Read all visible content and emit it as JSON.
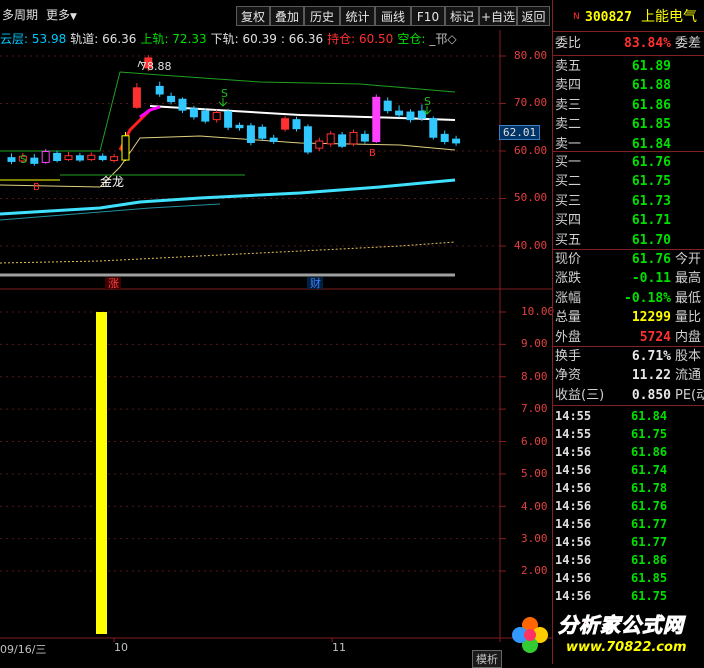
{
  "toolbar": {
    "period": "多周期",
    "more": "更多",
    "buttons": [
      "复权",
      "叠加",
      "历史",
      "统计",
      "画线",
      "F10",
      "标记",
      "+自选",
      "返回"
    ]
  },
  "indicators": [
    {
      "text": "云层: 53.98",
      "color": "#00c8ff"
    },
    {
      "text": "轨道: 66.36",
      "color": "#e0e0e0"
    },
    {
      "text": "上轨: 72.33",
      "color": "#00e000"
    },
    {
      "text": "下轨: 60.39",
      "color": "#e0e0e0"
    },
    {
      "text": ": 66.36",
      "color": "#e0e0e0"
    },
    {
      "text": "持仓: 60.50",
      "color": "#ff3030"
    },
    {
      "text": "空仓:",
      "color": "#00e000"
    },
    {
      "text": "_邗◇",
      "color": "#c0c0c0"
    }
  ],
  "main_axis": [
    "80.00",
    "70.00",
    "60.00",
    "50.00",
    "40.00"
  ],
  "current_price_tag": "62.01",
  "high_label": "78.88",
  "golden_dragon": "金龙",
  "signal_s": "S",
  "signal_b": "B",
  "markers": {
    "zhang": "涨",
    "cai": "财"
  },
  "vol_axis": [
    "10.00",
    "9.00",
    "8.00",
    "7.00",
    "6.00",
    "5.00",
    "4.00",
    "3.00",
    "2.00"
  ],
  "dates": [
    "09/16/三",
    "10",
    "11"
  ],
  "bottom_tab": "模析",
  "stock": {
    "badge": "N",
    "code": "300827",
    "name": "上能电气"
  },
  "weibi": {
    "label": "委比",
    "value": "83.84%",
    "label2": "委差"
  },
  "asks": [
    {
      "label": "卖五",
      "price": "61.89"
    },
    {
      "label": "卖四",
      "price": "61.88"
    },
    {
      "label": "卖三",
      "price": "61.86"
    },
    {
      "label": "卖二",
      "price": "61.85"
    },
    {
      "label": "卖一",
      "price": "61.84"
    }
  ],
  "bids": [
    {
      "label": "买一",
      "price": "61.76"
    },
    {
      "label": "买二",
      "price": "61.75"
    },
    {
      "label": "买三",
      "price": "61.73"
    },
    {
      "label": "买四",
      "price": "61.71"
    },
    {
      "label": "买五",
      "price": "61.70"
    }
  ],
  "quote": [
    {
      "label": "现价",
      "value": "61.76",
      "color": "#00e000",
      "label2": "今开"
    },
    {
      "label": "涨跌",
      "value": "-0.11",
      "color": "#00e000",
      "label2": "最高"
    },
    {
      "label": "涨幅",
      "value": "-0.18%",
      "color": "#00e000",
      "label2": "最低"
    },
    {
      "label": "总量",
      "value": "12299",
      "color": "#ffff00",
      "label2": "量比"
    },
    {
      "label": "外盘",
      "value": "5724",
      "color": "#ff3030",
      "label2": "内盘"
    }
  ],
  "fundamentals": [
    {
      "label": "换手",
      "value": "6.71%",
      "label2": "股本"
    },
    {
      "label": "净资",
      "value": "11.22",
      "label2": "流通"
    },
    {
      "label": "收益(三)",
      "value": "0.850",
      "label2": "PE(动"
    }
  ],
  "ticks": [
    {
      "time": "14:55",
      "price": "61.84"
    },
    {
      "time": "14:55",
      "price": "61.75"
    },
    {
      "time": "14:56",
      "price": "61.86"
    },
    {
      "time": "14:56",
      "price": "61.74"
    },
    {
      "time": "14:56",
      "price": "61.78"
    },
    {
      "time": "14:56",
      "price": "61.76"
    },
    {
      "time": "14:56",
      "price": "61.77"
    },
    {
      "time": "14:56",
      "price": "61.77"
    },
    {
      "time": "14:56",
      "price": "61.86"
    },
    {
      "time": "14:56",
      "price": "61.85"
    },
    {
      "time": "14:56",
      "price": "61.75"
    }
  ],
  "watermark": {
    "text": "分析家公式网",
    "url": "www.70822.com"
  },
  "candles": [
    {
      "o": 58.6,
      "c": 57.8,
      "h": 59.5,
      "l": 57.2
    },
    {
      "o": 57.9,
      "c": 58.9,
      "h": 59.6,
      "l": 57.5
    },
    {
      "o": 58.5,
      "c": 57.4,
      "h": 59.4,
      "l": 56.9
    },
    {
      "o": 57.6,
      "c": 59.9,
      "h": 60.4,
      "l": 57.3
    },
    {
      "o": 59.5,
      "c": 58.0,
      "h": 60.1,
      "l": 57.6
    },
    {
      "o": 58.2,
      "c": 59.0,
      "h": 59.8,
      "l": 57.9
    },
    {
      "o": 59.0,
      "c": 58.1,
      "h": 59.6,
      "l": 57.7
    },
    {
      "o": 58.2,
      "c": 59.1,
      "h": 59.7,
      "l": 57.9
    },
    {
      "o": 58.9,
      "c": 58.2,
      "h": 59.5,
      "l": 57.8
    },
    {
      "o": 58.0,
      "c": 58.8,
      "h": 59.4,
      "l": 57.6
    },
    {
      "o": 58.1,
      "c": 63.2,
      "h": 64.0,
      "l": 57.9
    },
    {
      "o": 69.2,
      "c": 73.3,
      "h": 74.3,
      "l": 68.9
    },
    {
      "o": 77.5,
      "c": 79.6,
      "h": 80.2,
      "l": 76.8
    },
    {
      "o": 73.6,
      "c": 72.0,
      "h": 74.6,
      "l": 71.4
    },
    {
      "o": 71.5,
      "c": 70.4,
      "h": 72.3,
      "l": 69.8
    },
    {
      "o": 70.9,
      "c": 68.6,
      "h": 71.3,
      "l": 68.0
    },
    {
      "o": 68.9,
      "c": 67.2,
      "h": 69.5,
      "l": 66.6
    },
    {
      "o": 68.4,
      "c": 66.3,
      "h": 69.0,
      "l": 65.8
    },
    {
      "o": 66.6,
      "c": 68.1,
      "h": 68.7,
      "l": 66.0
    },
    {
      "o": 68.3,
      "c": 65.0,
      "h": 68.9,
      "l": 64.4
    },
    {
      "o": 65.4,
      "c": 64.9,
      "h": 66.0,
      "l": 64.3
    },
    {
      "o": 65.3,
      "c": 61.8,
      "h": 65.9,
      "l": 61.2
    },
    {
      "o": 65.0,
      "c": 62.7,
      "h": 65.6,
      "l": 62.1
    },
    {
      "o": 62.7,
      "c": 62.0,
      "h": 63.4,
      "l": 61.5
    },
    {
      "o": 64.6,
      "c": 66.8,
      "h": 67.3,
      "l": 64.1
    },
    {
      "o": 66.6,
      "c": 64.7,
      "h": 67.2,
      "l": 64.1
    },
    {
      "o": 65.1,
      "c": 59.8,
      "h": 65.6,
      "l": 59.3
    },
    {
      "o": 60.6,
      "c": 62.1,
      "h": 62.8,
      "l": 60.0
    },
    {
      "o": 61.5,
      "c": 63.6,
      "h": 64.2,
      "l": 60.9
    },
    {
      "o": 63.4,
      "c": 61.0,
      "h": 64.0,
      "l": 60.6
    },
    {
      "o": 61.5,
      "c": 63.9,
      "h": 64.5,
      "l": 61.0
    },
    {
      "o": 63.5,
      "c": 62.1,
      "h": 64.3,
      "l": 61.6
    },
    {
      "o": 62.0,
      "c": 71.3,
      "h": 71.9,
      "l": 61.7
    },
    {
      "o": 70.5,
      "c": 68.5,
      "h": 71.3,
      "l": 67.9
    },
    {
      "o": 68.4,
      "c": 67.6,
      "h": 69.6,
      "l": 67.0
    },
    {
      "o": 68.2,
      "c": 66.6,
      "h": 68.8,
      "l": 66.0
    },
    {
      "o": 68.4,
      "c": 66.9,
      "h": 69.8,
      "l": 66.3
    },
    {
      "o": 66.8,
      "c": 62.9,
      "h": 67.3,
      "l": 62.4
    },
    {
      "o": 63.5,
      "c": 62.0,
      "h": 64.3,
      "l": 61.4
    },
    {
      "o": 62.5,
      "c": 61.7,
      "h": 63.2,
      "l": 61.1
    }
  ],
  "volume_value": 10.0
}
